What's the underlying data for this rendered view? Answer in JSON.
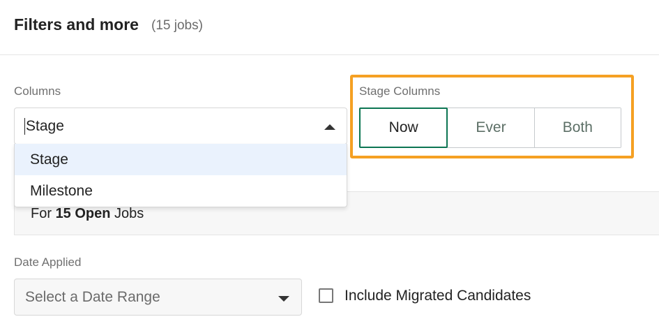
{
  "header": {
    "title": "Filters and more",
    "count": "(15 jobs)"
  },
  "columns": {
    "label": "Columns",
    "value": "Stage",
    "options": [
      "Stage",
      "Milestone"
    ]
  },
  "stage_columns": {
    "label": "Stage Columns",
    "segments": [
      "Now",
      "Ever",
      "Both"
    ],
    "active": "Now",
    "highlight_color": "#f5a023",
    "active_color": "#0c7552"
  },
  "info": {
    "prefix": "For",
    "count_bold": "15 Open",
    "suffix": "Jobs"
  },
  "date_applied": {
    "label": "Date Applied",
    "placeholder": "Select a Date Range"
  },
  "migrated": {
    "label": "Include Migrated Candidates",
    "checked": false
  }
}
